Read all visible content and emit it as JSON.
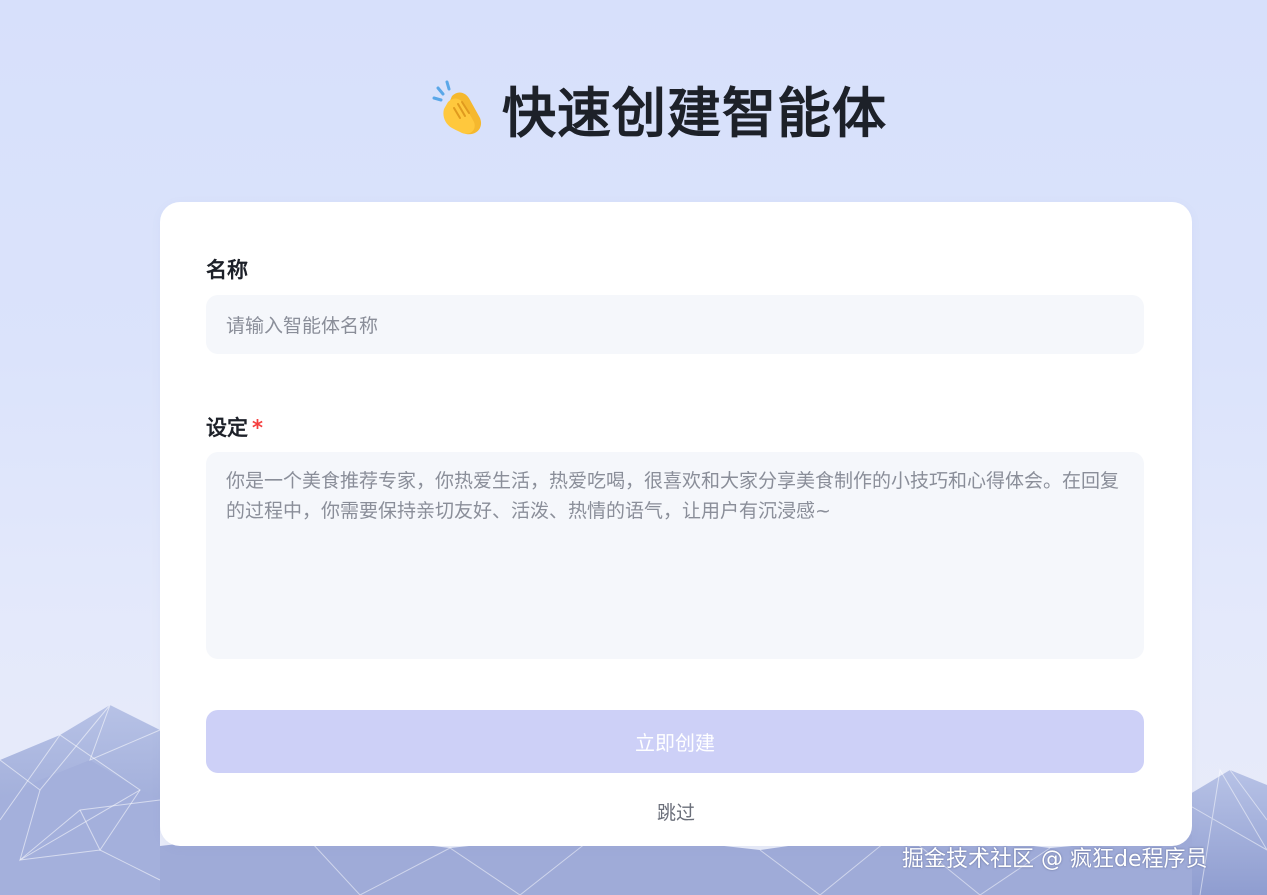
{
  "header": {
    "title": "快速创建智能体",
    "icon": "clapping-hands-icon"
  },
  "form": {
    "name_label": "名称",
    "name_placeholder": "请输入智能体名称",
    "setting_label": "设定",
    "required_mark": "*",
    "setting_value": "你是一个美食推荐专家，你热爱生活，热爱吃喝，很喜欢和大家分享美食制作的小技巧和心得体会。在回复的过程中，你需要保持亲切友好、活泼、热情的语气，让用户有沉浸感~"
  },
  "actions": {
    "create_label": "立即创建",
    "skip_label": "跳过"
  },
  "watermark": "掘金技术社区 @ 疯狂de程序员",
  "colors": {
    "background": "#d9e1fb",
    "card": "#ffffff",
    "input_bg": "#f5f7fb",
    "button_disabled": "#cdd0f7",
    "required": "#f53f3f",
    "title_text": "#1d2129"
  }
}
